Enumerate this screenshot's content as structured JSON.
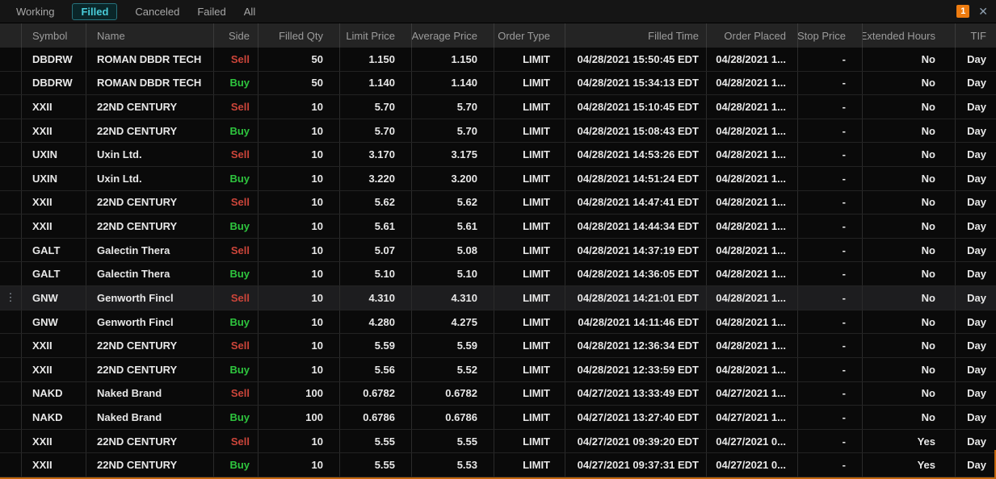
{
  "window": {
    "alert_badge": "1",
    "close_icon": "✕"
  },
  "tabs": [
    {
      "label": "Working",
      "active": false
    },
    {
      "label": "Filled",
      "active": true
    },
    {
      "label": "Canceled",
      "active": false
    },
    {
      "label": "Failed",
      "active": false
    },
    {
      "label": "All",
      "active": false
    }
  ],
  "colors": {
    "accent_teal": "#49ccd9",
    "sell_red": "#cc453a",
    "buy_green": "#2ec53e",
    "badge_orange": "#ee7c10",
    "window_border_orange": "#c2660b"
  },
  "table": {
    "columns": [
      {
        "key": "action",
        "label": ""
      },
      {
        "key": "symbol",
        "label": "Symbol"
      },
      {
        "key": "name",
        "label": "Name"
      },
      {
        "key": "side",
        "label": "Side"
      },
      {
        "key": "filledQty",
        "label": "Filled Qty"
      },
      {
        "key": "limitPrice",
        "label": "Limit Price"
      },
      {
        "key": "avgPrice",
        "label": "Average Price"
      },
      {
        "key": "orderType",
        "label": "Order Type"
      },
      {
        "key": "filledTime",
        "label": "Filled Time"
      },
      {
        "key": "orderPlaced",
        "label": "Order Placed"
      },
      {
        "key": "stopPrice",
        "label": "Stop Price"
      },
      {
        "key": "extHours",
        "label": "Extended Hours"
      },
      {
        "key": "tif",
        "label": "TIF"
      }
    ],
    "rows": [
      {
        "symbol": "DBDRW",
        "name": "ROMAN DBDR TECH",
        "side": "Sell",
        "filledQty": "50",
        "limitPrice": "1.150",
        "avgPrice": "1.150",
        "orderType": "LIMIT",
        "filledTime": "04/28/2021 15:50:45 EDT",
        "orderPlaced": "04/28/2021 1...",
        "stopPrice": "-",
        "extHours": "No",
        "tif": "Day",
        "highlighted": false
      },
      {
        "symbol": "DBDRW",
        "name": "ROMAN DBDR TECH",
        "side": "Buy",
        "filledQty": "50",
        "limitPrice": "1.140",
        "avgPrice": "1.140",
        "orderType": "LIMIT",
        "filledTime": "04/28/2021 15:34:13 EDT",
        "orderPlaced": "04/28/2021 1...",
        "stopPrice": "-",
        "extHours": "No",
        "tif": "Day",
        "highlighted": false
      },
      {
        "symbol": "XXII",
        "name": "22ND CENTURY",
        "side": "Sell",
        "filledQty": "10",
        "limitPrice": "5.70",
        "avgPrice": "5.70",
        "orderType": "LIMIT",
        "filledTime": "04/28/2021 15:10:45 EDT",
        "orderPlaced": "04/28/2021 1...",
        "stopPrice": "-",
        "extHours": "No",
        "tif": "Day",
        "highlighted": false
      },
      {
        "symbol": "XXII",
        "name": "22ND CENTURY",
        "side": "Buy",
        "filledQty": "10",
        "limitPrice": "5.70",
        "avgPrice": "5.70",
        "orderType": "LIMIT",
        "filledTime": "04/28/2021 15:08:43 EDT",
        "orderPlaced": "04/28/2021 1...",
        "stopPrice": "-",
        "extHours": "No",
        "tif": "Day",
        "highlighted": false
      },
      {
        "symbol": "UXIN",
        "name": "Uxin Ltd.",
        "side": "Sell",
        "filledQty": "10",
        "limitPrice": "3.170",
        "avgPrice": "3.175",
        "orderType": "LIMIT",
        "filledTime": "04/28/2021 14:53:26 EDT",
        "orderPlaced": "04/28/2021 1...",
        "stopPrice": "-",
        "extHours": "No",
        "tif": "Day",
        "highlighted": false
      },
      {
        "symbol": "UXIN",
        "name": "Uxin Ltd.",
        "side": "Buy",
        "filledQty": "10",
        "limitPrice": "3.220",
        "avgPrice": "3.200",
        "orderType": "LIMIT",
        "filledTime": "04/28/2021 14:51:24 EDT",
        "orderPlaced": "04/28/2021 1...",
        "stopPrice": "-",
        "extHours": "No",
        "tif": "Day",
        "highlighted": false
      },
      {
        "symbol": "XXII",
        "name": "22ND CENTURY",
        "side": "Sell",
        "filledQty": "10",
        "limitPrice": "5.62",
        "avgPrice": "5.62",
        "orderType": "LIMIT",
        "filledTime": "04/28/2021 14:47:41 EDT",
        "orderPlaced": "04/28/2021 1...",
        "stopPrice": "-",
        "extHours": "No",
        "tif": "Day",
        "highlighted": false
      },
      {
        "symbol": "XXII",
        "name": "22ND CENTURY",
        "side": "Buy",
        "filledQty": "10",
        "limitPrice": "5.61",
        "avgPrice": "5.61",
        "orderType": "LIMIT",
        "filledTime": "04/28/2021 14:44:34 EDT",
        "orderPlaced": "04/28/2021 1...",
        "stopPrice": "-",
        "extHours": "No",
        "tif": "Day",
        "highlighted": false
      },
      {
        "symbol": "GALT",
        "name": "Galectin Thera",
        "side": "Sell",
        "filledQty": "10",
        "limitPrice": "5.07",
        "avgPrice": "5.08",
        "orderType": "LIMIT",
        "filledTime": "04/28/2021 14:37:19 EDT",
        "orderPlaced": "04/28/2021 1...",
        "stopPrice": "-",
        "extHours": "No",
        "tif": "Day",
        "highlighted": false
      },
      {
        "symbol": "GALT",
        "name": "Galectin Thera",
        "side": "Buy",
        "filledQty": "10",
        "limitPrice": "5.10",
        "avgPrice": "5.10",
        "orderType": "LIMIT",
        "filledTime": "04/28/2021 14:36:05 EDT",
        "orderPlaced": "04/28/2021 1...",
        "stopPrice": "-",
        "extHours": "No",
        "tif": "Day",
        "highlighted": false
      },
      {
        "symbol": "GNW",
        "name": "Genworth Fincl",
        "side": "Sell",
        "filledQty": "10",
        "limitPrice": "4.310",
        "avgPrice": "4.310",
        "orderType": "LIMIT",
        "filledTime": "04/28/2021 14:21:01 EDT",
        "orderPlaced": "04/28/2021 1...",
        "stopPrice": "-",
        "extHours": "No",
        "tif": "Day",
        "highlighted": true
      },
      {
        "symbol": "GNW",
        "name": "Genworth Fincl",
        "side": "Buy",
        "filledQty": "10",
        "limitPrice": "4.280",
        "avgPrice": "4.275",
        "orderType": "LIMIT",
        "filledTime": "04/28/2021 14:11:46 EDT",
        "orderPlaced": "04/28/2021 1...",
        "stopPrice": "-",
        "extHours": "No",
        "tif": "Day",
        "highlighted": false
      },
      {
        "symbol": "XXII",
        "name": "22ND CENTURY",
        "side": "Sell",
        "filledQty": "10",
        "limitPrice": "5.59",
        "avgPrice": "5.59",
        "orderType": "LIMIT",
        "filledTime": "04/28/2021 12:36:34 EDT",
        "orderPlaced": "04/28/2021 1...",
        "stopPrice": "-",
        "extHours": "No",
        "tif": "Day",
        "highlighted": false
      },
      {
        "symbol": "XXII",
        "name": "22ND CENTURY",
        "side": "Buy",
        "filledQty": "10",
        "limitPrice": "5.56",
        "avgPrice": "5.52",
        "orderType": "LIMIT",
        "filledTime": "04/28/2021 12:33:59 EDT",
        "orderPlaced": "04/28/2021 1...",
        "stopPrice": "-",
        "extHours": "No",
        "tif": "Day",
        "highlighted": false
      },
      {
        "symbol": "NAKD",
        "name": "Naked Brand",
        "side": "Sell",
        "filledQty": "100",
        "limitPrice": "0.6782",
        "avgPrice": "0.6782",
        "orderType": "LIMIT",
        "filledTime": "04/27/2021 13:33:49 EDT",
        "orderPlaced": "04/27/2021 1...",
        "stopPrice": "-",
        "extHours": "No",
        "tif": "Day",
        "highlighted": false
      },
      {
        "symbol": "NAKD",
        "name": "Naked Brand",
        "side": "Buy",
        "filledQty": "100",
        "limitPrice": "0.6786",
        "avgPrice": "0.6786",
        "orderType": "LIMIT",
        "filledTime": "04/27/2021 13:27:40 EDT",
        "orderPlaced": "04/27/2021 1...",
        "stopPrice": "-",
        "extHours": "No",
        "tif": "Day",
        "highlighted": false
      },
      {
        "symbol": "XXII",
        "name": "22ND CENTURY",
        "side": "Sell",
        "filledQty": "10",
        "limitPrice": "5.55",
        "avgPrice": "5.55",
        "orderType": "LIMIT",
        "filledTime": "04/27/2021 09:39:20 EDT",
        "orderPlaced": "04/27/2021 0...",
        "stopPrice": "-",
        "extHours": "Yes",
        "tif": "Day",
        "highlighted": false
      },
      {
        "symbol": "XXII",
        "name": "22ND CENTURY",
        "side": "Buy",
        "filledQty": "10",
        "limitPrice": "5.55",
        "avgPrice": "5.53",
        "orderType": "LIMIT",
        "filledTime": "04/27/2021 09:37:31 EDT",
        "orderPlaced": "04/27/2021 0...",
        "stopPrice": "-",
        "extHours": "Yes",
        "tif": "Day",
        "highlighted": false
      }
    ]
  }
}
